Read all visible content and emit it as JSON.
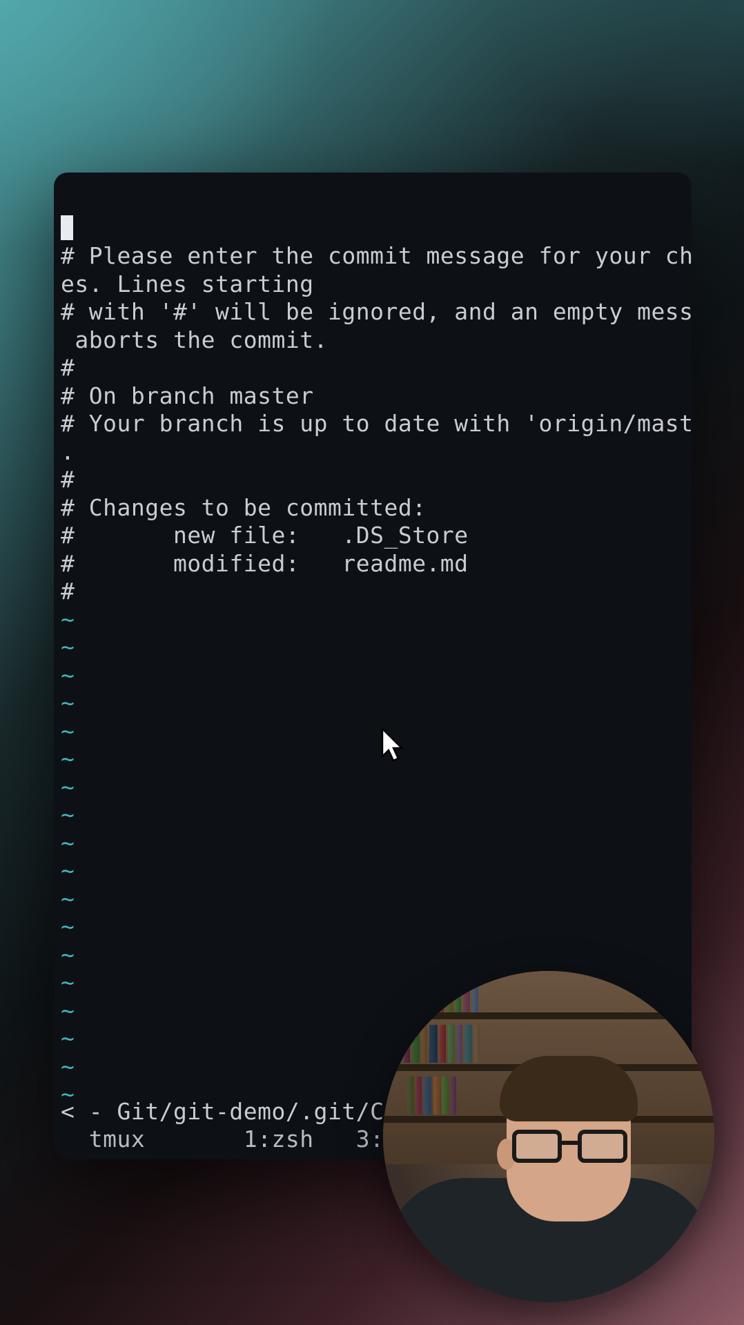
{
  "editor": {
    "lines": [
      "# Please enter the commit message for your chang",
      "es. Lines starting",
      "# with '#' will be ignored, and an empty message",
      " aborts the commit.",
      "#",
      "# On branch master",
      "# Your branch is up to date with 'origin/master'",
      ".",
      "#",
      "# Changes to be committed:",
      "#       new file:   .DS_Store",
      "#       modified:   readme.md",
      "#"
    ],
    "tilde": "~",
    "tilde_count": 18,
    "status_line": "< - Git/git-demo/.git/COMM",
    "tmux": {
      "session": "tmux",
      "win1": "1:zsh",
      "win2": "3:z"
    }
  },
  "colors": {
    "terminal_bg": "#0d1015",
    "text": "#c8cdd4",
    "tilde": "#3fb8c4"
  }
}
